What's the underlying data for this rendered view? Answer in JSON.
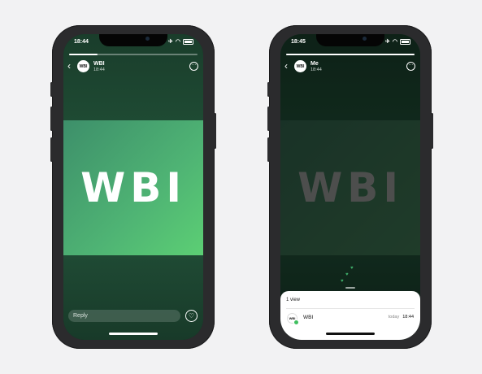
{
  "left_phone": {
    "status_time": "18:44",
    "contact_name": "WBI",
    "post_time": "18:44",
    "avatar_text": "WBI",
    "story_text": "WBI",
    "reply_placeholder": "Reply"
  },
  "right_phone": {
    "status_time": "18:45",
    "contact_name": "Me",
    "post_time": "18:44",
    "avatar_text": "WBI",
    "story_text": "WBI",
    "views_label": "1 view",
    "viewer": {
      "avatar_text": "WBI",
      "name": "WBI",
      "day": "today",
      "time": "18:44"
    }
  },
  "icons": {
    "back": "chevron-left-icon",
    "more": "more-icon",
    "heart": "heart-icon",
    "wifi": "wifi-icon",
    "location": "location-arrow-icon",
    "airplane": "airplane-icon",
    "battery": "battery-icon"
  },
  "colors": {
    "accent": "#5ccf74",
    "online": "#3fbf5f"
  }
}
